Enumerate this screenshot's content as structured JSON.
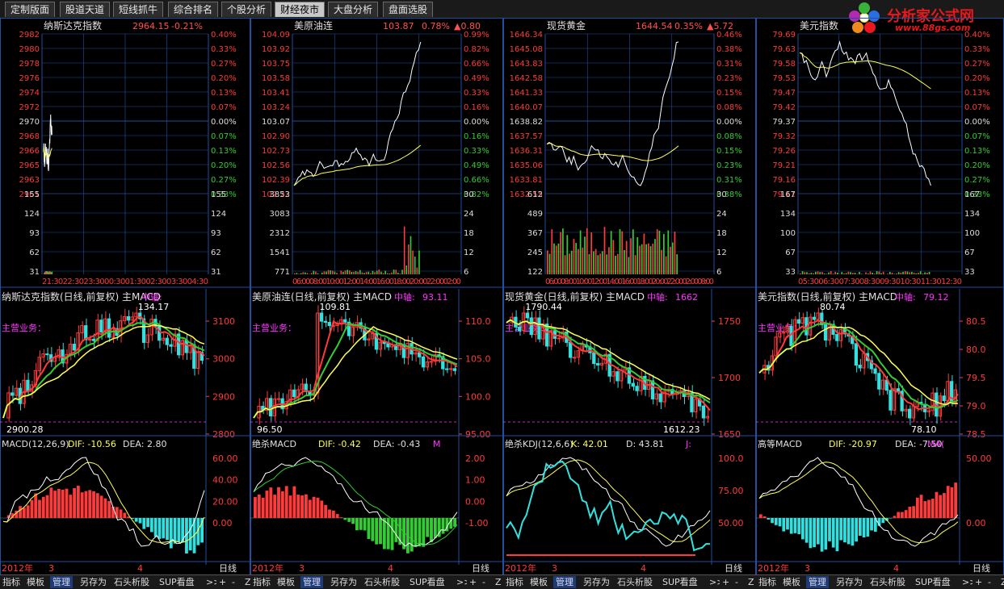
{
  "tabs": [
    "定制版面",
    "股道天道",
    "短线抓牛",
    "综合排名",
    "个股分析",
    "财经夜市",
    "大盘分析",
    "盘面选股"
  ],
  "active_tab": 5,
  "logo": {
    "text": "分析家公式网",
    "url": "www.88gs.com"
  },
  "colors": {
    "red": "#ff3a3a",
    "green": "#33cc33",
    "cyan": "#33e0e0",
    "yellow": "#ffff55",
    "magenta": "#ff33ff",
    "white": "#ffffff",
    "grid": "#8b0000",
    "frame": "#2050a0"
  },
  "panels": [
    {
      "id": "p1",
      "name": "纳斯达克指数",
      "value": "2964.15",
      "change": "-0.21%",
      "extra": "",
      "price_left": [
        "2982",
        "2980",
        "2978",
        "2976",
        "2974",
        "2972",
        "2970",
        "2968",
        "2966",
        "2965",
        "2963",
        "2961"
      ],
      "price_right": [
        "0.40%",
        "0.33%",
        "0.27%",
        "0.20%",
        "0.13%",
        "0.07%",
        "0.00%",
        "0.07%",
        "0.13%",
        "0.20%",
        "0.27%",
        "0.33%"
      ],
      "vol_left": [
        "155",
        "124",
        "93",
        "62",
        "31"
      ],
      "vol_right": [
        "155",
        "124",
        "93",
        "62",
        "31"
      ],
      "time_labels": "21:3022:3023:3000:3001:3002:3003:3004:30",
      "day_title": "纳斯达克指数(日线,前复权) 主MACD",
      "mid_label": "中轴:",
      "mid_val": "",
      "day_axis": [
        "3100",
        "3000",
        "2900",
        "2800"
      ],
      "hi": "134.17",
      "lo": "2900.28",
      "biz": "主营业务：",
      "ind_title": "MACD(12,26,9)",
      "ind_a": "DIF: -10.56",
      "ind_b": "DEA: 2.80",
      "ind_c": "",
      "ind_axis": [
        "60.00",
        "40.00",
        "20.00",
        "0.00"
      ],
      "date_left": "2012年",
      "d1": "3",
      "d2": "4",
      "period": "日线"
    },
    {
      "id": "p2",
      "name": "美原油连",
      "value": "103.87",
      "change": "0.78%",
      "extra": "▲0.80",
      "price_left": [
        "104.09",
        "103.92",
        "103.75",
        "103.58",
        "103.41",
        "103.24",
        "103.07",
        "102.90",
        "102.73",
        "102.56",
        "102.39",
        "102.22"
      ],
      "price_right": [
        "0.99%",
        "0.82%",
        "0.66%",
        "0.49%",
        "0.33%",
        "0.16%",
        "0.00%",
        "0.16%",
        "0.33%",
        "0.49%",
        "0.66%",
        "0.82%"
      ],
      "vol_left": [
        "3853",
        "3083",
        "2312",
        "1541",
        "771"
      ],
      "vol_right": [
        "30",
        "24",
        "18",
        "12",
        "6"
      ],
      "time_labels": "06:0008:0010:0012:0014:0016:0018:0020:0022:0002:00",
      "day_title": "美原油连(日线,前复权) 主MACD",
      "mid_label": "中轴:",
      "mid_val": "93.11",
      "day_axis": [
        "110.0",
        "105.0",
        "100.0",
        "95.00"
      ],
      "hi": "109.81",
      "lo": "96.50",
      "biz": "主营业务：",
      "ind_title": "绝杀MACD",
      "ind_a": "DIF: -0.42",
      "ind_b": "DEA: -0.43",
      "ind_c": "M",
      "ind_axis": [
        "2.00",
        "1.00",
        "0.00",
        "-1.00"
      ],
      "date_left": "2012年",
      "d1": "3",
      "d2": "4",
      "period": "日线"
    },
    {
      "id": "p3",
      "name": "现货黄金",
      "value": "1644.54",
      "change": "0.35%",
      "extra": "▲5.72",
      "price_left": [
        "1646.34",
        "1645.08",
        "1643.83",
        "1642.58",
        "1641.33",
        "1640.07",
        "1638.82",
        "1637.57",
        "1636.31",
        "1635.06",
        "1633.81",
        "1632.55"
      ],
      "price_right": [
        "0.46%",
        "0.38%",
        "0.31%",
        "0.23%",
        "0.15%",
        "0.08%",
        "0.00%",
        "0.08%",
        "0.15%",
        "0.23%",
        "0.31%",
        "0.38%"
      ],
      "vol_left": [
        "612",
        "489",
        "367",
        "245",
        "122"
      ],
      "vol_right": [
        "30",
        "24",
        "18",
        "12",
        "6"
      ],
      "time_labels": "06:0008:0010:0012:0014:0016:0018:0020:0022:0002:0008:00",
      "day_title": "现货黄金(日线,前复权) 主MACD",
      "mid_label": "中轴:",
      "mid_val": "1662",
      "day_axis": [
        "1750",
        "1700",
        "1650"
      ],
      "hi": "1790.44",
      "lo": "1612.23",
      "biz": "主营业务：",
      "ind_title": "绝杀KDJ(12,6,6)",
      "ind_a": "K: 42.01",
      "ind_b": "D: 43.81",
      "ind_c": "J:",
      "ind_axis": [
        "100.0",
        "75.00",
        "50.00"
      ],
      "date_left": "2012年",
      "d1": "3",
      "d2": "4",
      "period": "日线"
    },
    {
      "id": "p4",
      "name": "美元指数",
      "value": "",
      "change": "",
      "extra": "",
      "price_left": [
        "79.69",
        "79.63",
        "79.58",
        "79.53",
        "79.47",
        "79.42",
        "79.37",
        "79.32",
        "79.26",
        "79.21",
        "79.16",
        "79.11"
      ],
      "price_right": [
        "0.40%",
        "0.33%",
        "0.27%",
        "0.20%",
        "0.13%",
        "0.07%",
        "0.00%",
        "0.07%",
        "0.13%",
        "0.20%",
        "0.27%",
        "0.33%"
      ],
      "vol_left": [
        "167",
        "134",
        "100",
        "67",
        "33"
      ],
      "vol_right": [
        "167",
        "134",
        "100",
        "67",
        "33"
      ],
      "time_labels": "05:3006:3007:3008:3009:3010:3011:3012:30",
      "day_title": "美元指数(日线,前复权) 主MACD",
      "mid_label": "中轴:",
      "mid_val": "79.12",
      "day_axis": [
        "80.5",
        "80.0",
        "79.5",
        "79.0",
        "78.5"
      ],
      "hi": "80.74",
      "lo": "78.10",
      "biz": "主营业务：",
      "ind_title": "高等MACD",
      "ind_a": "DIF: -20.97",
      "ind_b": "DEA: -7.50",
      "ind_c": "MA(",
      "ind_axis": [
        "50.00",
        "0.00"
      ],
      "date_left": "2012年",
      "d1": "3",
      "d2": "4",
      "period": "日线"
    }
  ],
  "toolbar": [
    "指标",
    "模板",
    "管理",
    "另存为",
    "石头析股",
    "SUP看盘"
  ],
  "toolbar_extra": [
    ">>",
    "+",
    "-",
    "Z"
  ]
}
